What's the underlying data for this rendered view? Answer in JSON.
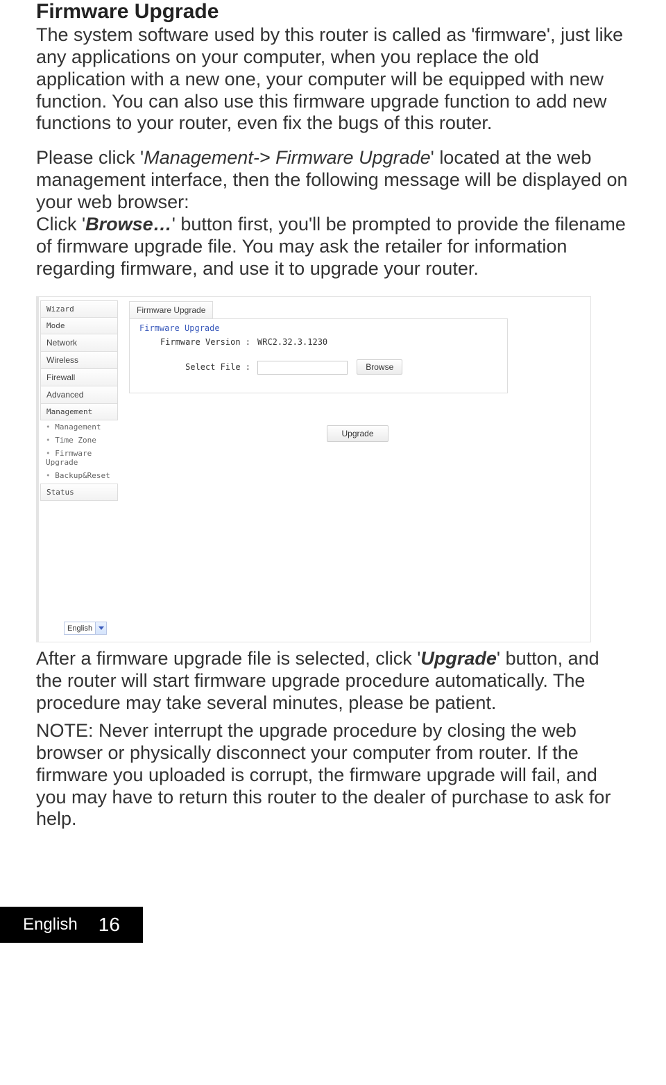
{
  "doc": {
    "heading": "Firmware Upgrade",
    "p1": "The system software used by this router is called as 'firmware', just like any applications on your computer, when you replace the old application with a new one, your computer will be equipped with new function. You can also use this firmware upgrade function to add new functions to your router, even fix the bugs of this router.",
    "p2_a": "Please click '",
    "p2_em1": "Management-> Firmware Upgrade",
    "p2_b": "' located at the web management interface, then the following message will be displayed on your web browser:",
    "p3_a": "Click '",
    "p3_em1": "Browse…",
    "p3_b": "' button first, you'll be prompted to provide the filename of firmware upgrade file. You may ask the retailer for information regarding firmware, and use it to upgrade your router.",
    "after1_a": "After a firmware upgrade file is selected, click '",
    "after1_em": "Upgrade",
    "after1_b": "' button, and the router will start firmware upgrade procedure automatically. The procedure may take several minutes, please be patient.",
    "note": "NOTE: Never interrupt the upgrade procedure by closing the web browser or physically disconnect your computer from router. If the firmware you uploaded is corrupt, the firmware upgrade will fail, and you may have to return this router to the dealer of purchase to ask for help."
  },
  "ui": {
    "nav": {
      "wizard": "Wizard",
      "mode": "Mode",
      "network": "Network",
      "wireless": "Wireless",
      "firewall": "Firewall",
      "advanced": "Advanced",
      "management": "Management",
      "status": "Status"
    },
    "subnav": {
      "management": "Management",
      "time_zone": "Time Zone",
      "firmware_upgrade": "Firmware Upgrade",
      "backup_reset": "Backup&Reset"
    },
    "tab_label": "Firmware Upgrade",
    "panel": {
      "title": "Firmware Upgrade",
      "version_label": "Firmware Version :",
      "version_value": "WRC2.32.3.1230",
      "select_file_label": "Select File :",
      "browse_btn": "Browse",
      "upgrade_btn": "Upgrade"
    },
    "language": "English"
  },
  "footer": {
    "language": "English",
    "page_number": "16"
  }
}
